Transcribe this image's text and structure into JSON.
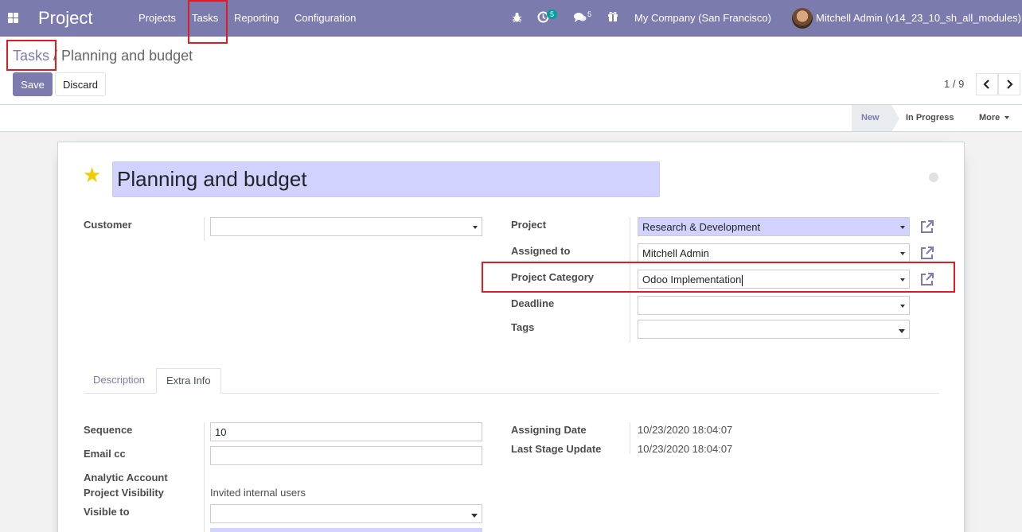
{
  "navbar": {
    "brand": "Project",
    "menu": [
      "Projects",
      "Tasks",
      "Reporting",
      "Configuration"
    ],
    "activity_count": "5",
    "message_count": "5",
    "company": "My Company (San Francisco)",
    "user": "Mitchell Admin (v14_23_10_sh_all_modules)"
  },
  "breadcrumb": {
    "parent": "Tasks",
    "separator": " / ",
    "current": "Planning and budget"
  },
  "buttons": {
    "save": "Save",
    "discard": "Discard"
  },
  "pager": {
    "value": "1 / 9"
  },
  "stages": [
    "New",
    "In Progress",
    "More"
  ],
  "task": {
    "title": "Planning and budget"
  },
  "fields": {
    "customer_label": "Customer",
    "customer_value": "",
    "project_label": "Project",
    "project_value": "Research & Development",
    "assigned_label": "Assigned to",
    "assigned_value": "Mitchell Admin",
    "category_label": "Project Category",
    "category_value": "Odoo Implementation",
    "deadline_label": "Deadline",
    "deadline_value": "",
    "tags_label": "Tags",
    "tags_value": ""
  },
  "tabs": [
    "Description",
    "Extra Info"
  ],
  "extra": {
    "sequence_label": "Sequence",
    "sequence_value": "10",
    "email_cc_label": "Email cc",
    "email_cc_value": "",
    "analytic_label": "Analytic Account",
    "visibility_label": "Project Visibility",
    "visibility_value": "Invited internal users",
    "visible_to_label": "Visible to",
    "assigning_date_label": "Assigning Date",
    "assigning_date_value": "10/23/2020 18:04:07",
    "last_stage_label": "Last Stage Update",
    "last_stage_value": "10/23/2020 18:04:07"
  },
  "colors": {
    "brand": "#7c7bad",
    "required_field": "#d2d2ff",
    "highlight": "#e01b24",
    "star": "#f3cc00"
  }
}
